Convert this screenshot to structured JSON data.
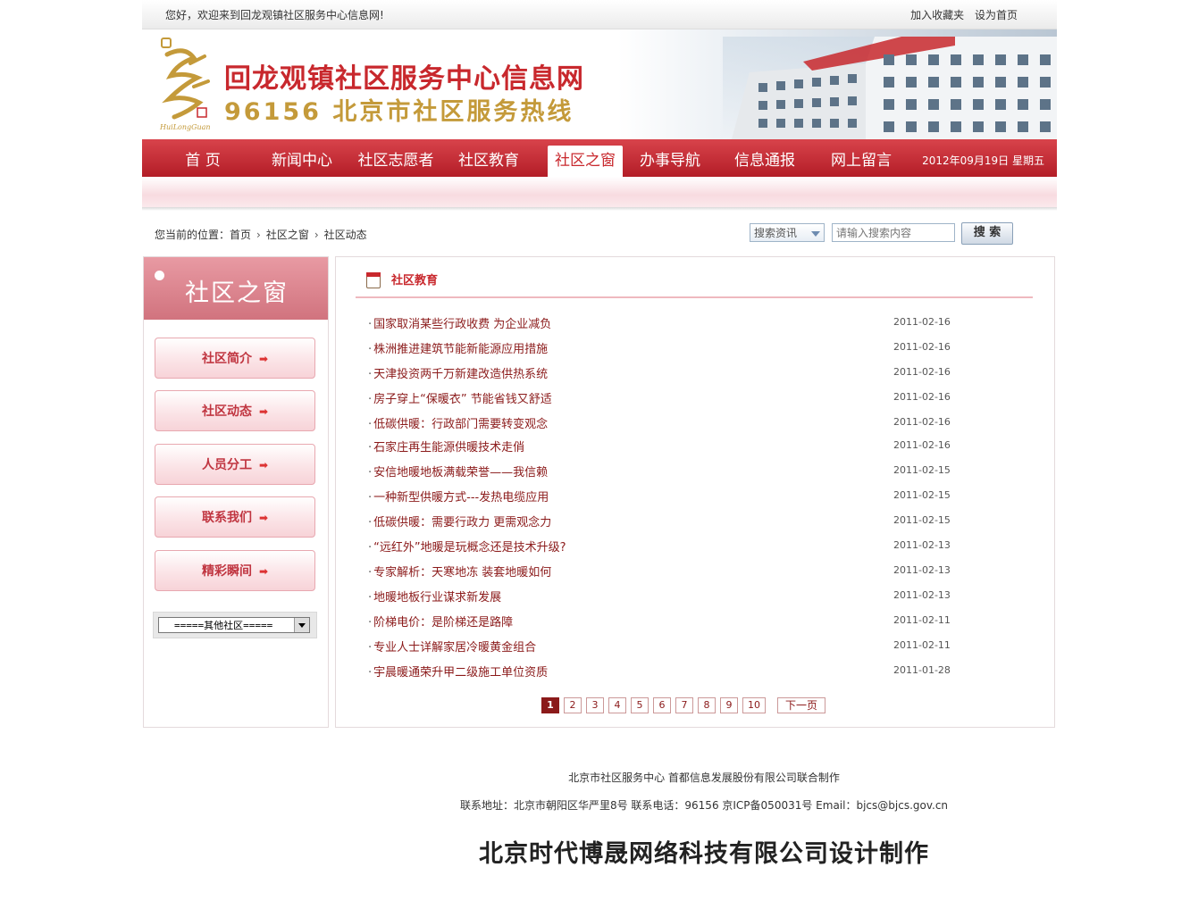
{
  "topbar": {
    "welcome": "您好，欢迎来到回龙观镇社区服务中心信息网!",
    "favorite": "加入收藏夹",
    "homepage": "设为首页"
  },
  "banner": {
    "title": "回龙观镇社区服务中心信息网",
    "subtitle": "96156 北京市社区服务热线",
    "logo_text": "HuiLongGuan"
  },
  "nav": {
    "items": [
      "首 页",
      "新闻中心",
      "社区志愿者",
      "社区教育",
      "社区之窗",
      "办事导航",
      "信息通报",
      "网上留言"
    ],
    "active_index": 4,
    "date": "2012年09月19日 星期五"
  },
  "breadcrumb": {
    "prefix": "您当前的位置：",
    "items": [
      "首页",
      "社区之窗",
      "社区动态"
    ]
  },
  "search": {
    "category": "搜索资讯",
    "placeholder": "请输入搜索内容",
    "button": "搜 索"
  },
  "sidebar": {
    "title": "社区之窗",
    "buttons": [
      "社区简介",
      "社区动态",
      "人员分工",
      "联系我们",
      "精彩瞬间"
    ],
    "select": "=====其他社区====="
  },
  "main": {
    "title": "社区教育",
    "articles": [
      {
        "title": "国家取消某些行政收费 为企业减负",
        "date": "2011-02-16"
      },
      {
        "title": "株洲推进建筑节能新能源应用措施",
        "date": "2011-02-16"
      },
      {
        "title": "天津投资两千万新建改造供热系统",
        "date": "2011-02-16"
      },
      {
        "title": "房子穿上“保暖衣” 节能省钱又舒适",
        "date": "2011-02-16"
      },
      {
        "title": "低碳供暖：行政部门需要转变观念",
        "date": "2011-02-16"
      },
      {
        "title": "石家庄再生能源供暖技术走俏",
        "date": "2011-02-16"
      },
      {
        "title": "安信地暖地板满载荣誉——我信赖",
        "date": "2011-02-15"
      },
      {
        "title": "一种新型供暖方式---发热电缆应用",
        "date": "2011-02-15"
      },
      {
        "title": "低碳供暖：需要行政力 更需观念力",
        "date": "2011-02-15"
      },
      {
        "title": "“远红外”地暖是玩概念还是技术升级?",
        "date": "2011-02-13"
      },
      {
        "title": "专家解析：天寒地冻 装套地暖如何",
        "date": "2011-02-13"
      },
      {
        "title": "地暖地板行业谋求新发展",
        "date": "2011-02-13"
      },
      {
        "title": "阶梯电价：是阶梯还是路障",
        "date": "2011-02-11"
      },
      {
        "title": "专业人士详解家居冷暖黄金组合",
        "date": "2011-02-11"
      },
      {
        "title": "宇晨暖通荣升甲二级施工单位资质",
        "date": "2011-01-28"
      }
    ],
    "pages": [
      "1",
      "2",
      "3",
      "4",
      "5",
      "6",
      "7",
      "8",
      "9",
      "10"
    ],
    "current_page": "1",
    "next": "下一页"
  },
  "footer": {
    "line1": "北京市社区服务中心 首都信息发展股份有限公司联合制作",
    "line2": "联系地址：北京市朝阳区华严里8号 联系电话：96156 京ICP备050031号 Email：bjcs@bjcs.gov.cn",
    "line3": "北京时代博晟网络科技有限公司设计制作"
  },
  "colors": {
    "brand_red": "#c8282d",
    "gold": "#c49a3a",
    "nav_gradient_top": "#d8434b",
    "nav_gradient_bottom": "#b31d27"
  }
}
